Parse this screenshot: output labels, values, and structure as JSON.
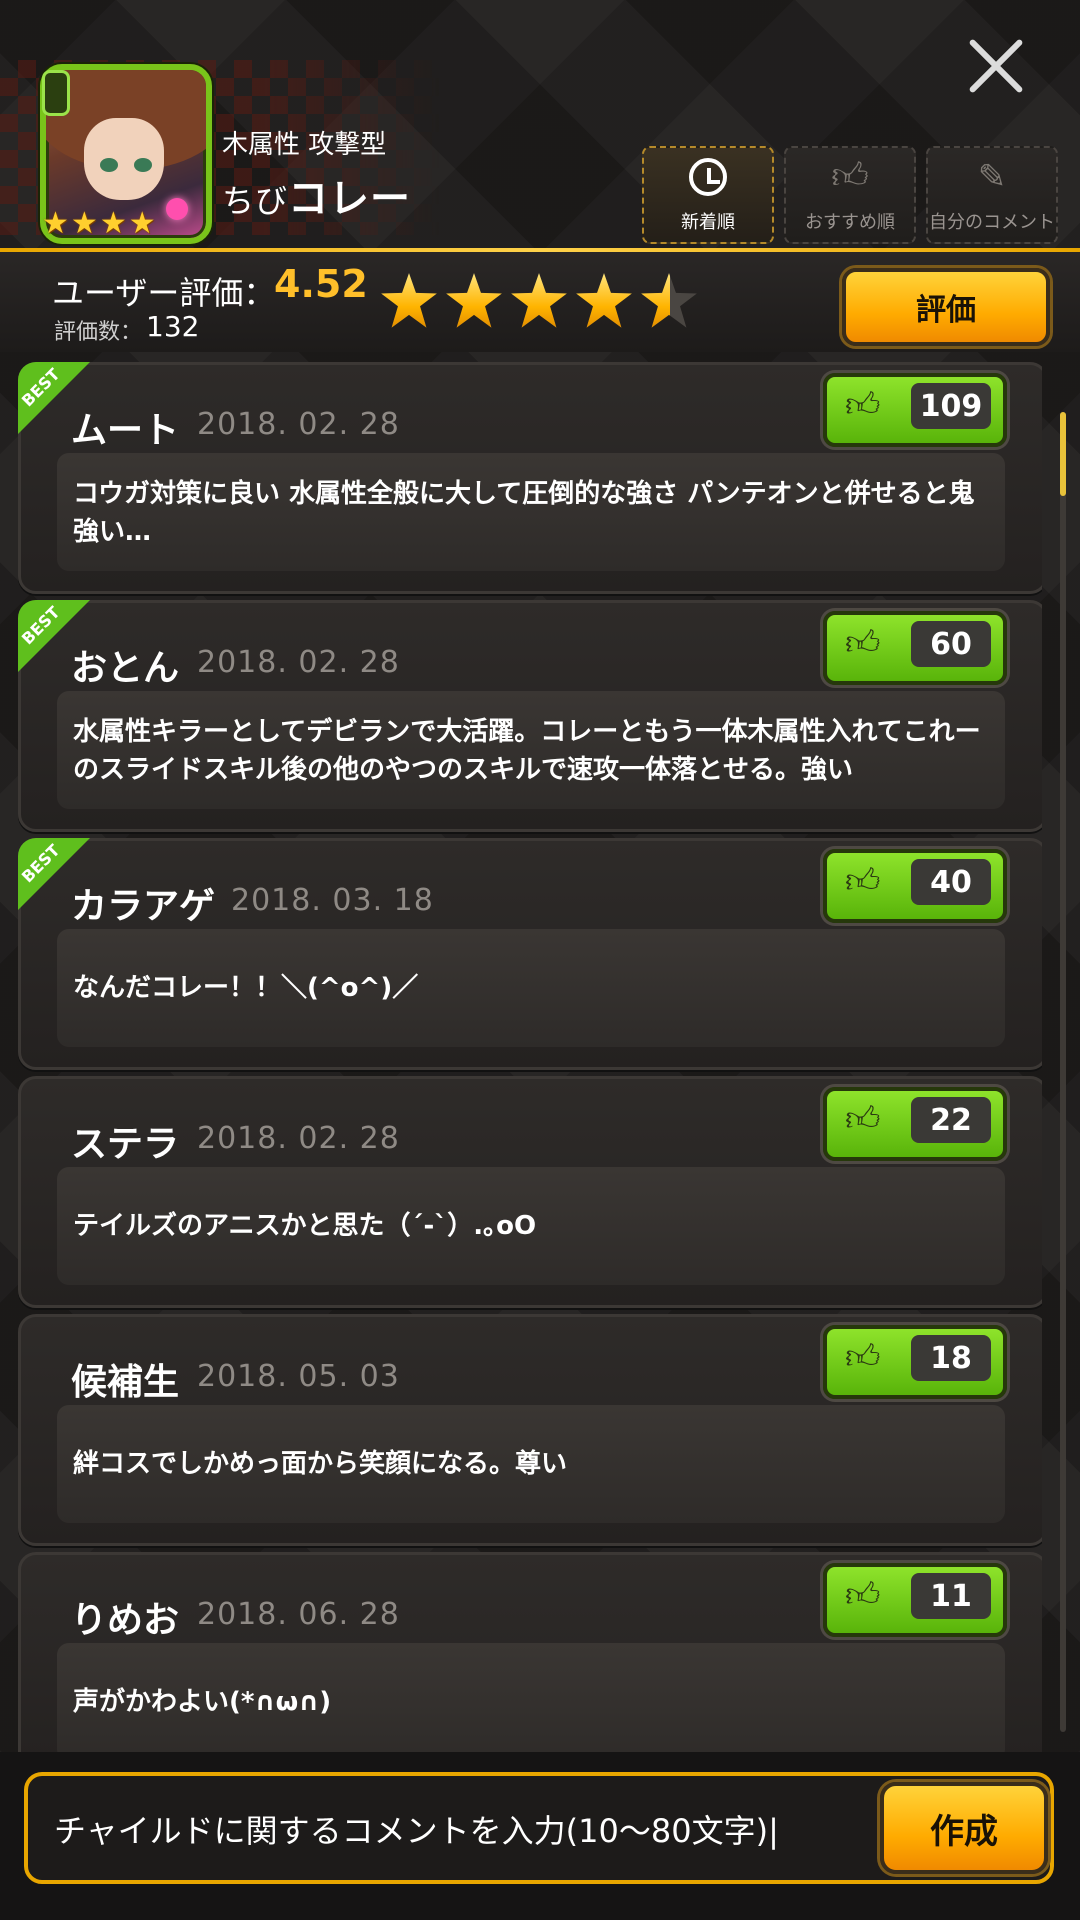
{
  "header": {
    "attribute": "木属性 攻撃型",
    "name_prefix": "ちび",
    "name_main": "コレー",
    "rarity_stars": 4,
    "tabs": [
      {
        "label": "新着順",
        "icon": "clock-icon",
        "active": true
      },
      {
        "label": "おすすめ順",
        "icon": "thumbs-up-icon",
        "active": false
      },
      {
        "label": "自分のコメント",
        "icon": "user-edit-icon",
        "active": false
      }
    ]
  },
  "rating": {
    "label": "ユーザー評価：",
    "value": "4.52",
    "count_label": "評価数：",
    "count": "132",
    "stars_value": 4.52,
    "button_label": "評価"
  },
  "comments": [
    {
      "author": "ムート",
      "date": "2018. 02. 28",
      "likes": "109",
      "best": true,
      "text": "コウガ対策に良い 水属性全般に大して圧倒的な強さ パンテオンと併せると鬼強い…"
    },
    {
      "author": "おとん",
      "date": "2018. 02. 28",
      "likes": "60",
      "best": true,
      "text": "水属性キラーとしてデビランで大活躍。コレーともう一体木属性入れてこれーのスライドスキル後の他のやつのスキルで速攻一体落とせる。強い"
    },
    {
      "author": "カラアゲ",
      "date": "2018. 03. 18",
      "likes": "40",
      "best": true,
      "text": "なんだコレー！！＼(^o^)／"
    },
    {
      "author": "ステラ",
      "date": "2018. 02. 28",
      "likes": "22",
      "best": false,
      "text": "テイルズのアニスかと思た（´-`）.｡oO"
    },
    {
      "author": "候補生",
      "date": "2018. 05. 03",
      "likes": "18",
      "best": false,
      "text": "絆コスでしかめっ面から笑顔になる。尊い"
    },
    {
      "author": "りめお",
      "date": "2018. 06. 28",
      "likes": "11",
      "best": false,
      "text": "声がかわよい(*∩ω∩)"
    }
  ],
  "best_badge": "BEST",
  "composer": {
    "placeholder": "チャイルドに関するコメントを入力(10〜80文字)|",
    "button_label": "作成"
  },
  "colors": {
    "accent_gold": "#ffb400",
    "like_green": "#6cc414",
    "best_green": "#5fbf1d"
  }
}
